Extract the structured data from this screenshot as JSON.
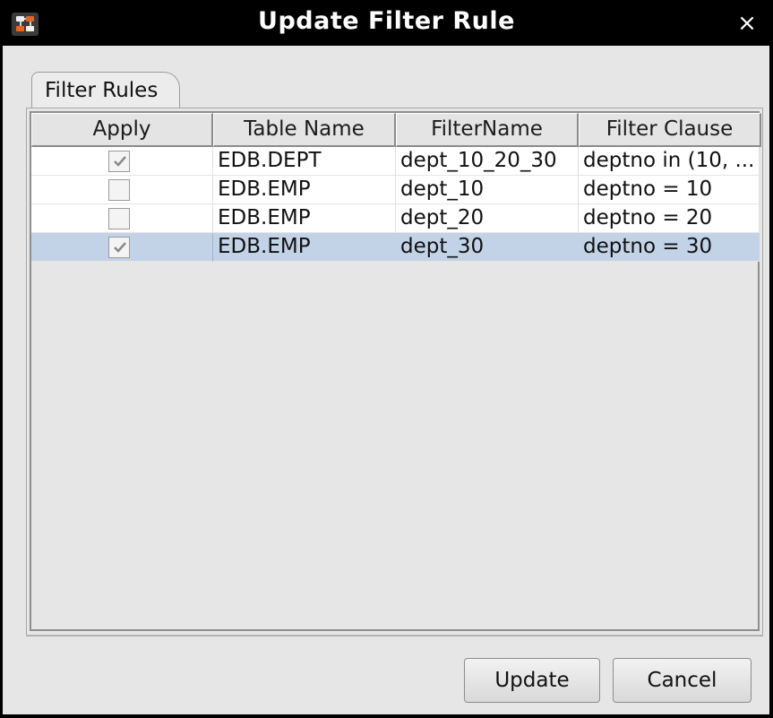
{
  "window": {
    "title": "Update Filter Rule",
    "close_glyph": "×",
    "icon": "app-logo-icon"
  },
  "tabs": [
    {
      "label": "Filter Rules"
    }
  ],
  "table": {
    "columns": [
      "Apply",
      "Table Name",
      "FilterName",
      "Filter Clause"
    ],
    "rows": [
      {
        "apply": true,
        "table_name": "EDB.DEPT",
        "filter_name": "dept_10_20_30",
        "filter_clause": "deptno in (10, ...",
        "selected": false
      },
      {
        "apply": false,
        "table_name": "EDB.EMP",
        "filter_name": "dept_10",
        "filter_clause": "deptno = 10",
        "selected": false
      },
      {
        "apply": false,
        "table_name": "EDB.EMP",
        "filter_name": "dept_20",
        "filter_clause": "deptno = 20",
        "selected": false
      },
      {
        "apply": true,
        "table_name": "EDB.EMP",
        "filter_name": "dept_30",
        "filter_clause": "deptno = 30",
        "selected": true
      }
    ]
  },
  "buttons": {
    "update": "Update",
    "cancel": "Cancel"
  },
  "colors": {
    "selection": "#c2d3e7",
    "titlebar": "#000000",
    "accent": "#e8622a"
  }
}
